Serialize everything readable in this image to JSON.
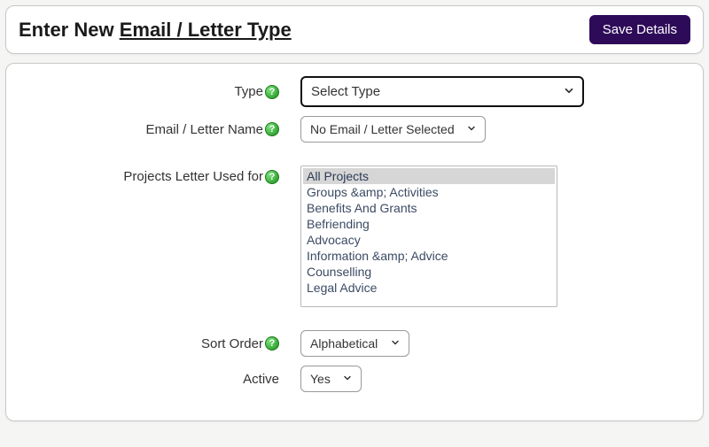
{
  "header": {
    "title_prefix": "Enter New ",
    "title_underlined": "Email / Letter Type",
    "save_label": "Save Details"
  },
  "form": {
    "type": {
      "label": "Type",
      "selected": "Select Type",
      "options": [
        "Select Type"
      ]
    },
    "name": {
      "label": "Email / Letter Name",
      "selected": "No Email / Letter Selected",
      "options": [
        "No Email / Letter Selected"
      ]
    },
    "projects": {
      "label": "Projects Letter Used for",
      "options": [
        "All Projects",
        "Groups &amp; Activities",
        "Benefits And Grants",
        "Befriending",
        "Advocacy",
        "Information &amp; Advice",
        "Counselling",
        "Legal Advice"
      ],
      "selected_index": 0
    },
    "sort_order": {
      "label": "Sort Order",
      "selected": "Alphabetical",
      "options": [
        "Alphabetical"
      ]
    },
    "active": {
      "label": "Active",
      "selected": "Yes",
      "options": [
        "Yes"
      ]
    }
  },
  "icons": {
    "help_glyph": "?"
  }
}
